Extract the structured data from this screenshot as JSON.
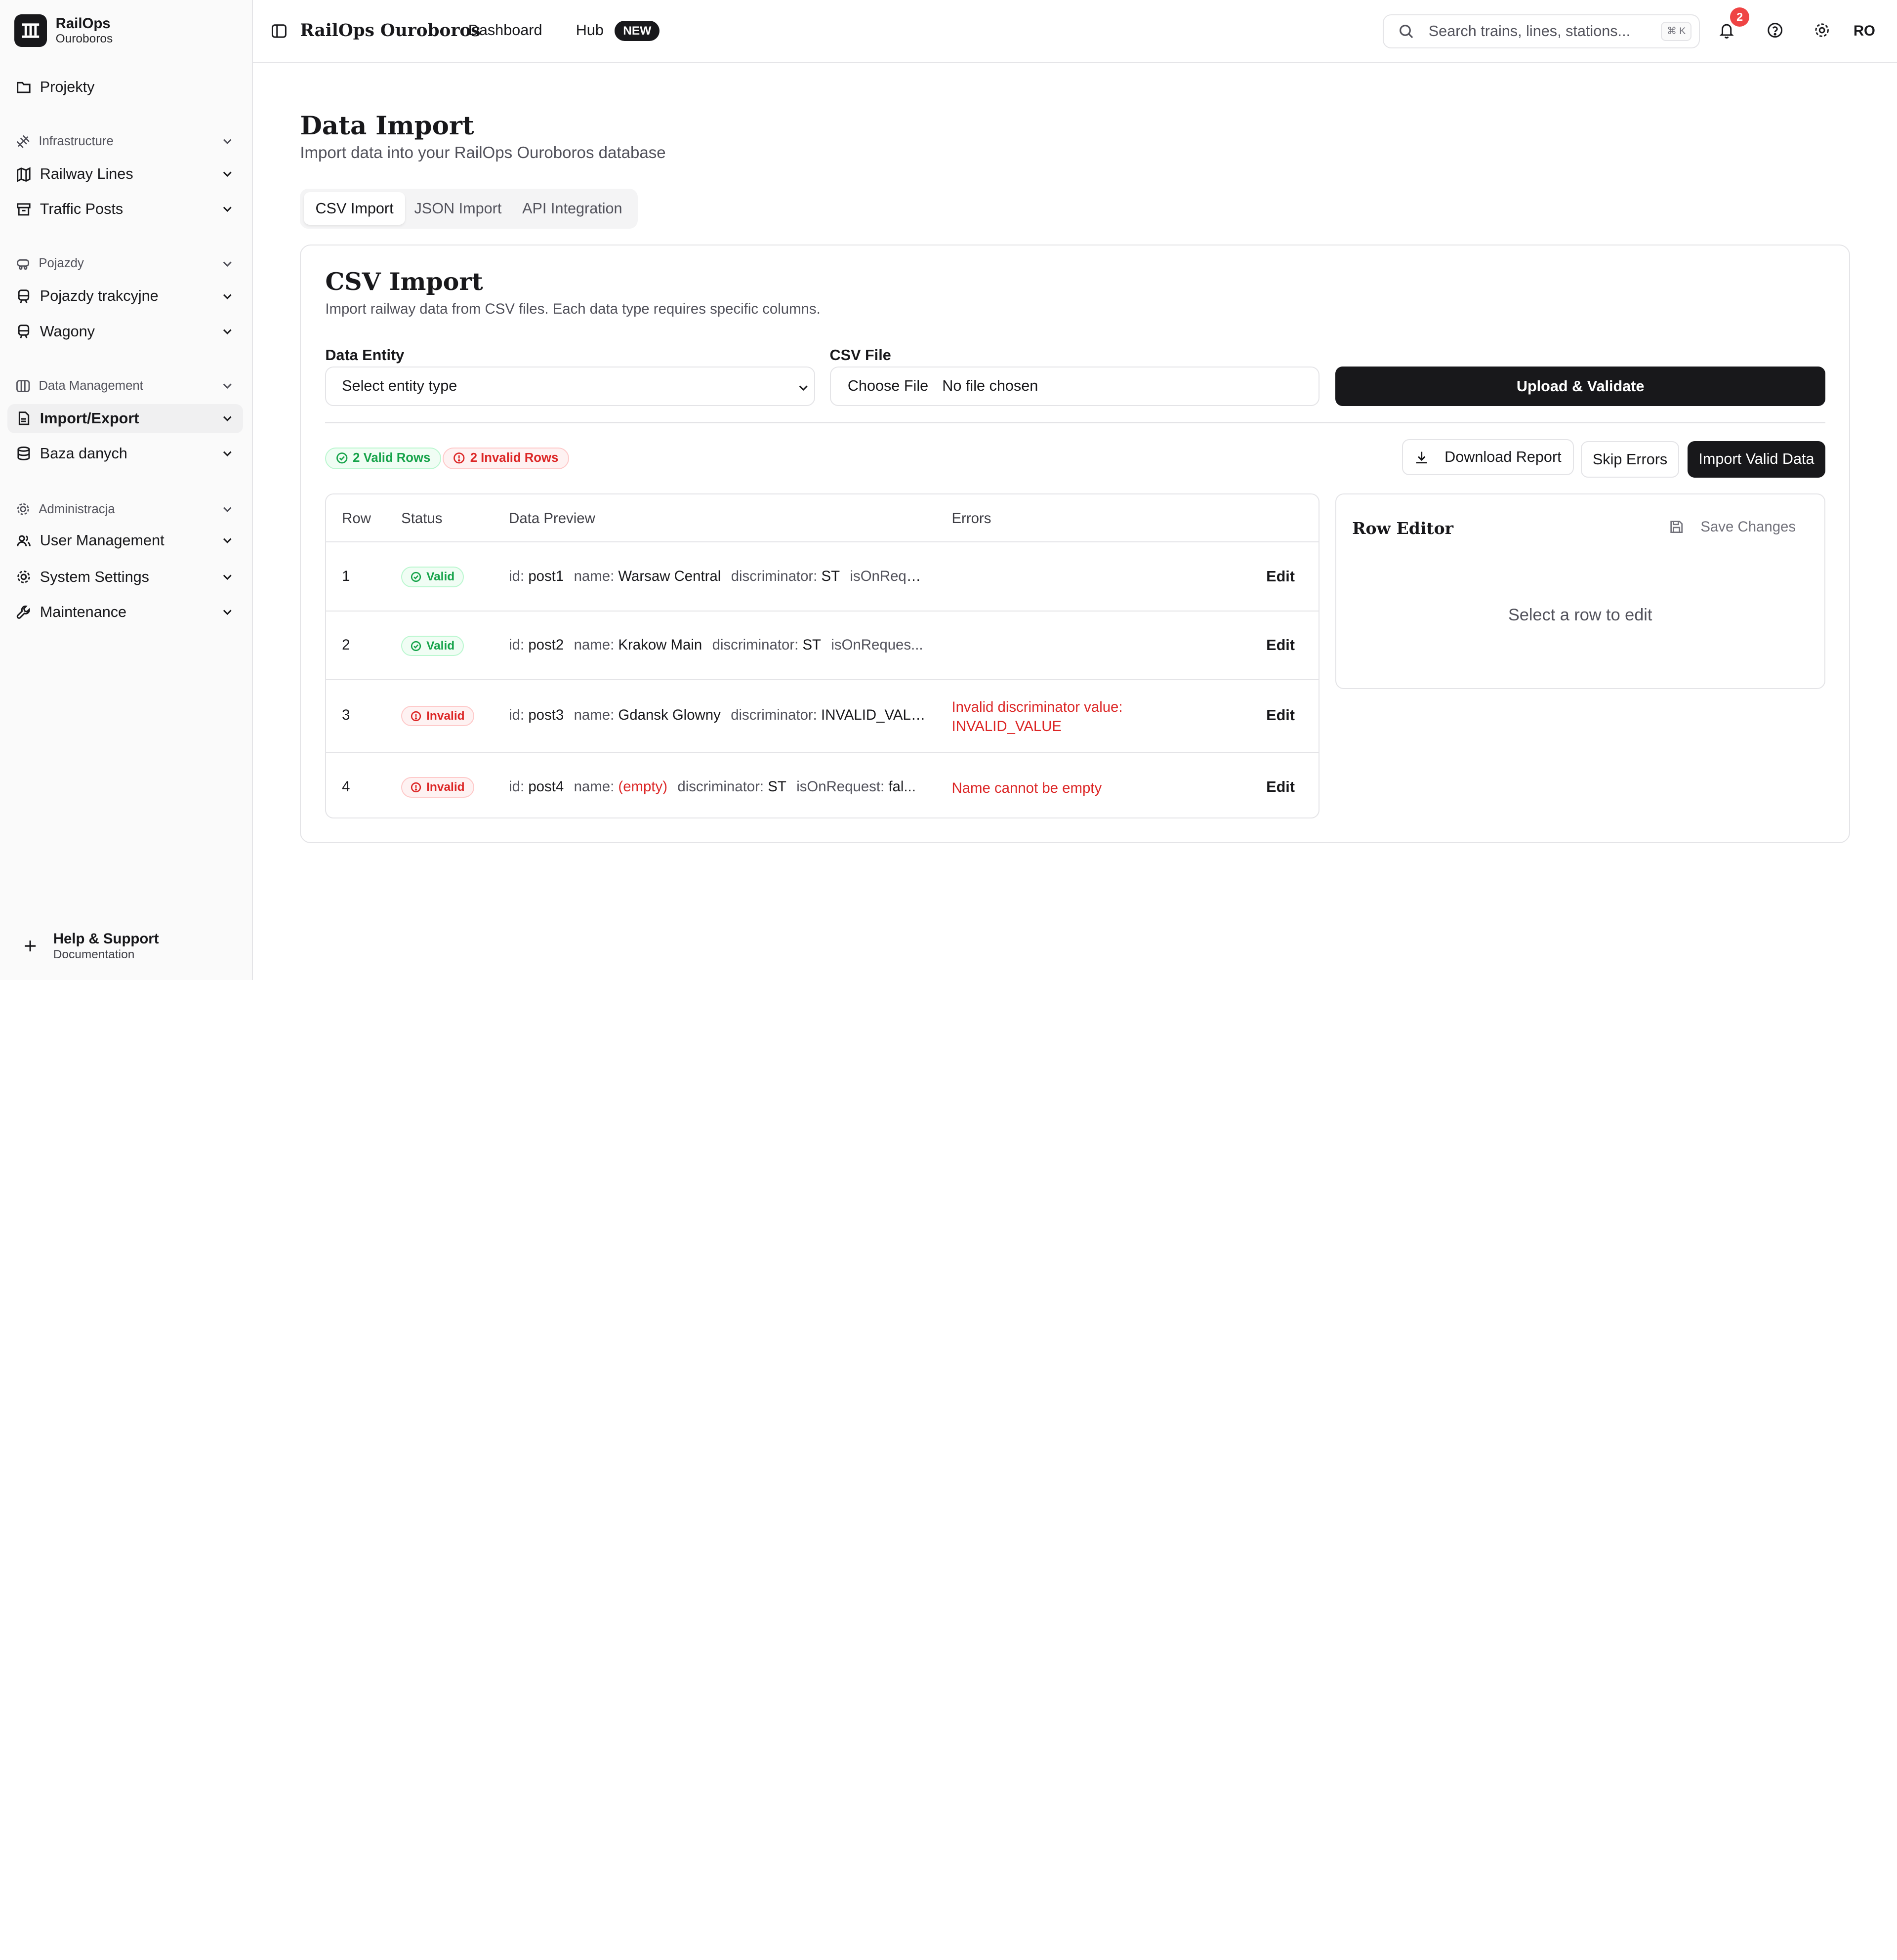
{
  "brand": {
    "title": "RailOps",
    "subtitle": "Ouroboros"
  },
  "sidebar": {
    "projekty": "Projekty",
    "groups": {
      "infrastructure": "Infrastructure",
      "pojazdy": "Pojazdy",
      "data_management": "Data Management",
      "administracja": "Administracja"
    },
    "items": {
      "railway_lines": "Railway Lines",
      "traffic_posts": "Traffic Posts",
      "pojazdy_trakcyjne": "Pojazdy trakcyjne",
      "wagony": "Wagony",
      "import_export": "Import/Export",
      "baza_danych": "Baza danych",
      "user_management": "User Management",
      "system_settings": "System Settings",
      "maintenance": "Maintenance"
    },
    "help": {
      "title": "Help & Support",
      "subtitle": "Documentation"
    }
  },
  "topbar": {
    "title": "RailOps Ouroboros",
    "dashboard": "Dashboard",
    "hub": "Hub",
    "hub_badge": "NEW",
    "search_placeholder": "Search trains, lines, stations...",
    "search_shortcut": "⌘ K",
    "notification_count": "2",
    "avatar": "RO"
  },
  "page": {
    "title": "Data Import",
    "subtitle": "Import data into your RailOps Ouroboros database",
    "tabs": [
      "CSV Import",
      "JSON Import",
      "API Integration"
    ]
  },
  "csv": {
    "title": "CSV Import",
    "subtitle": "Import railway data from CSV files. Each data type requires specific columns.",
    "entity_label": "Data Entity",
    "entity_placeholder": "Select entity type",
    "file_label": "CSV File",
    "file_button": "Choose File",
    "file_status": "No file chosen",
    "upload_button": "Upload & Validate",
    "valid_rows": "2 Valid Rows",
    "invalid_rows": "2 Invalid Rows",
    "download_report": "Download Report",
    "skip_errors": "Skip Errors",
    "import_valid": "Import Valid Data"
  },
  "table": {
    "headers": [
      "Row",
      "Status",
      "Data Preview",
      "Errors"
    ],
    "edit_label": "Edit",
    "rows": [
      {
        "row": "1",
        "status": "Valid",
        "id": "post1",
        "name": "Warsaw Central",
        "discriminator": "ST",
        "tail": "isOnRequ...",
        "error": ""
      },
      {
        "row": "2",
        "status": "Valid",
        "id": "post2",
        "name": "Krakow Main",
        "discriminator": "ST",
        "tail": "isOnReques...",
        "error": ""
      },
      {
        "row": "3",
        "status": "Invalid",
        "id": "post3",
        "name": "Gdansk Glowny",
        "discriminator": "INVALID_VAL...",
        "tail": "",
        "error": "Invalid discriminator value: INVALID_VALUE"
      },
      {
        "row": "4",
        "status": "Invalid",
        "id": "post4",
        "name": "(empty)",
        "discriminator": "ST",
        "tail": "isOnRequest:",
        "tail_value": "fal...",
        "error": "Name cannot be empty"
      }
    ],
    "keys": {
      "id": "id:",
      "name": "name:",
      "discriminator": "discriminator:"
    }
  },
  "editor": {
    "title": "Row Editor",
    "save": "Save Changes",
    "empty": "Select a row to edit"
  }
}
